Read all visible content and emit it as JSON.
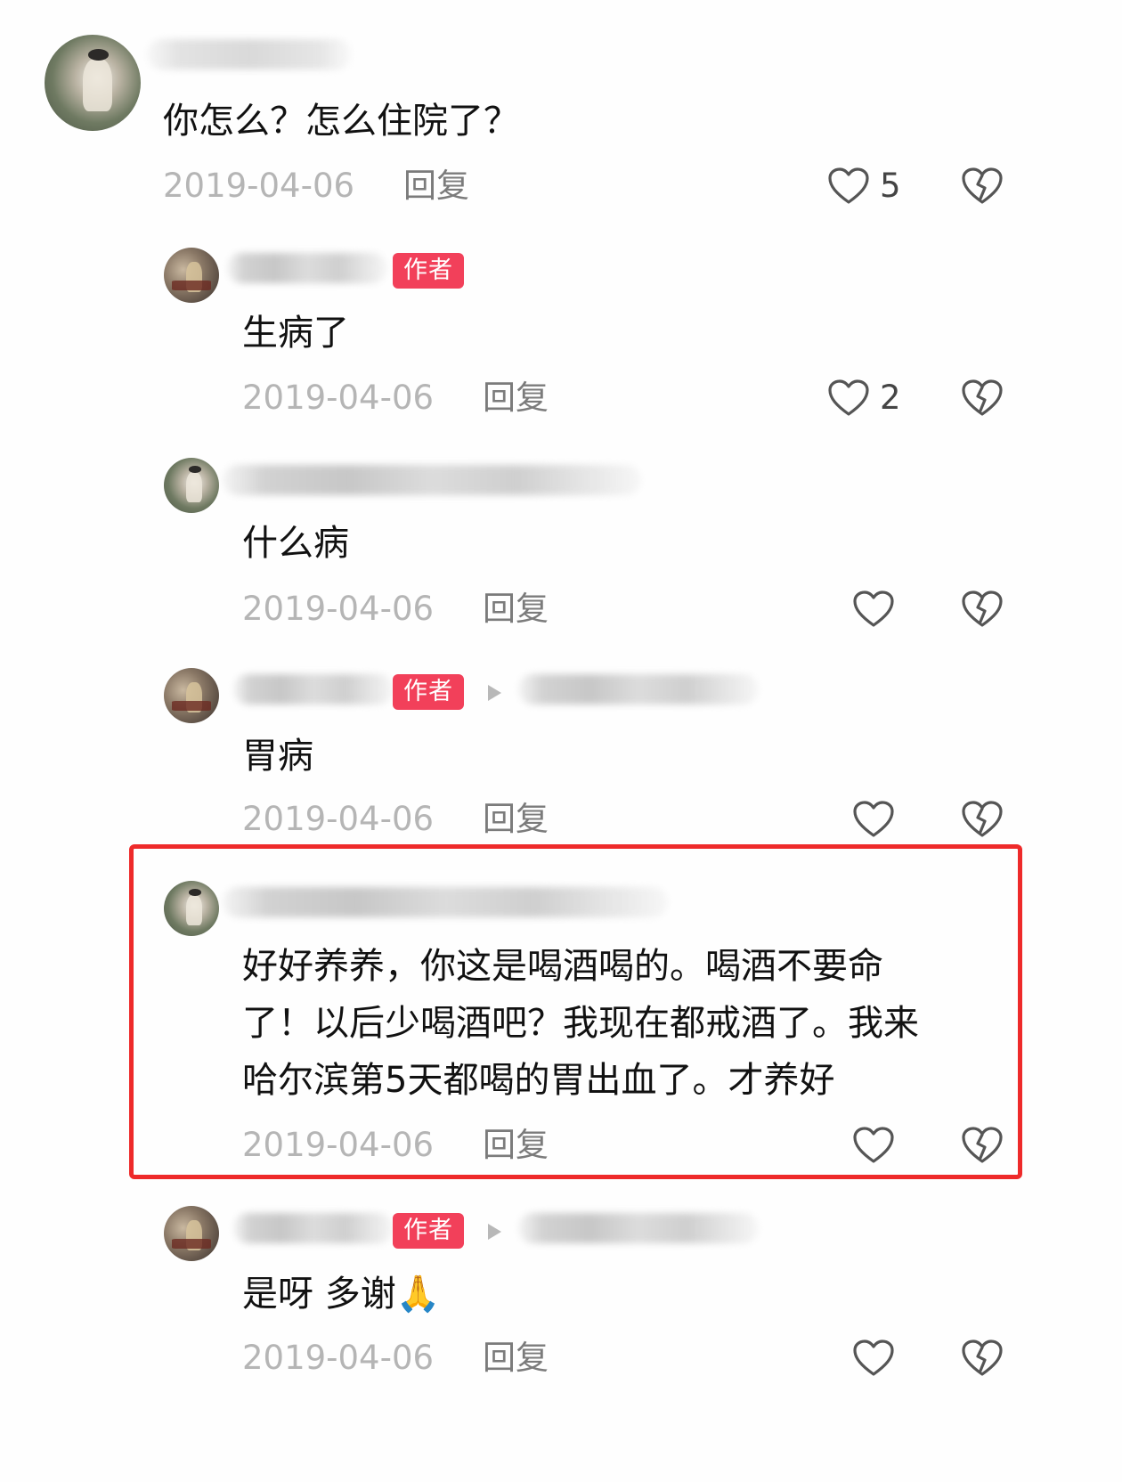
{
  "comments": [
    {
      "text": "你怎么？怎么住院了？",
      "date": "2019-04-06",
      "reply": "回复",
      "likes": "5",
      "is_author": false
    },
    {
      "text": "生病了",
      "date": "2019-04-06",
      "reply": "回复",
      "likes": "2",
      "badge": "作者",
      "is_author": true
    },
    {
      "text": "什么病",
      "date": "2019-04-06",
      "reply": "回复",
      "likes": "",
      "is_author": false
    },
    {
      "text": "胃病",
      "date": "2019-04-06",
      "reply": "回复",
      "likes": "",
      "badge": "作者",
      "is_author": true
    },
    {
      "text_lines": [
        "好好养养，你这是喝酒喝的。喝酒不要命",
        "了！以后少喝酒吧？我现在都戒酒了。我来",
        "哈尔滨第5天都喝的胃出血了。才养好"
      ],
      "date": "2019-04-06",
      "reply": "回复",
      "likes": "",
      "is_author": false,
      "highlighted": true
    },
    {
      "text": "是呀 多谢🙏",
      "date": "2019-04-06",
      "reply": "回复",
      "likes": "",
      "badge": "作者",
      "is_author": true
    }
  ],
  "icons": {
    "like": "heart-outline-icon",
    "dislike": "broken-heart-icon",
    "reply_to": "play-triangle-icon"
  },
  "colors": {
    "badge": "#f2405a",
    "highlight_border": "#ee2a2a",
    "date": "#b5b5b5",
    "reply": "#7b7b7b"
  }
}
